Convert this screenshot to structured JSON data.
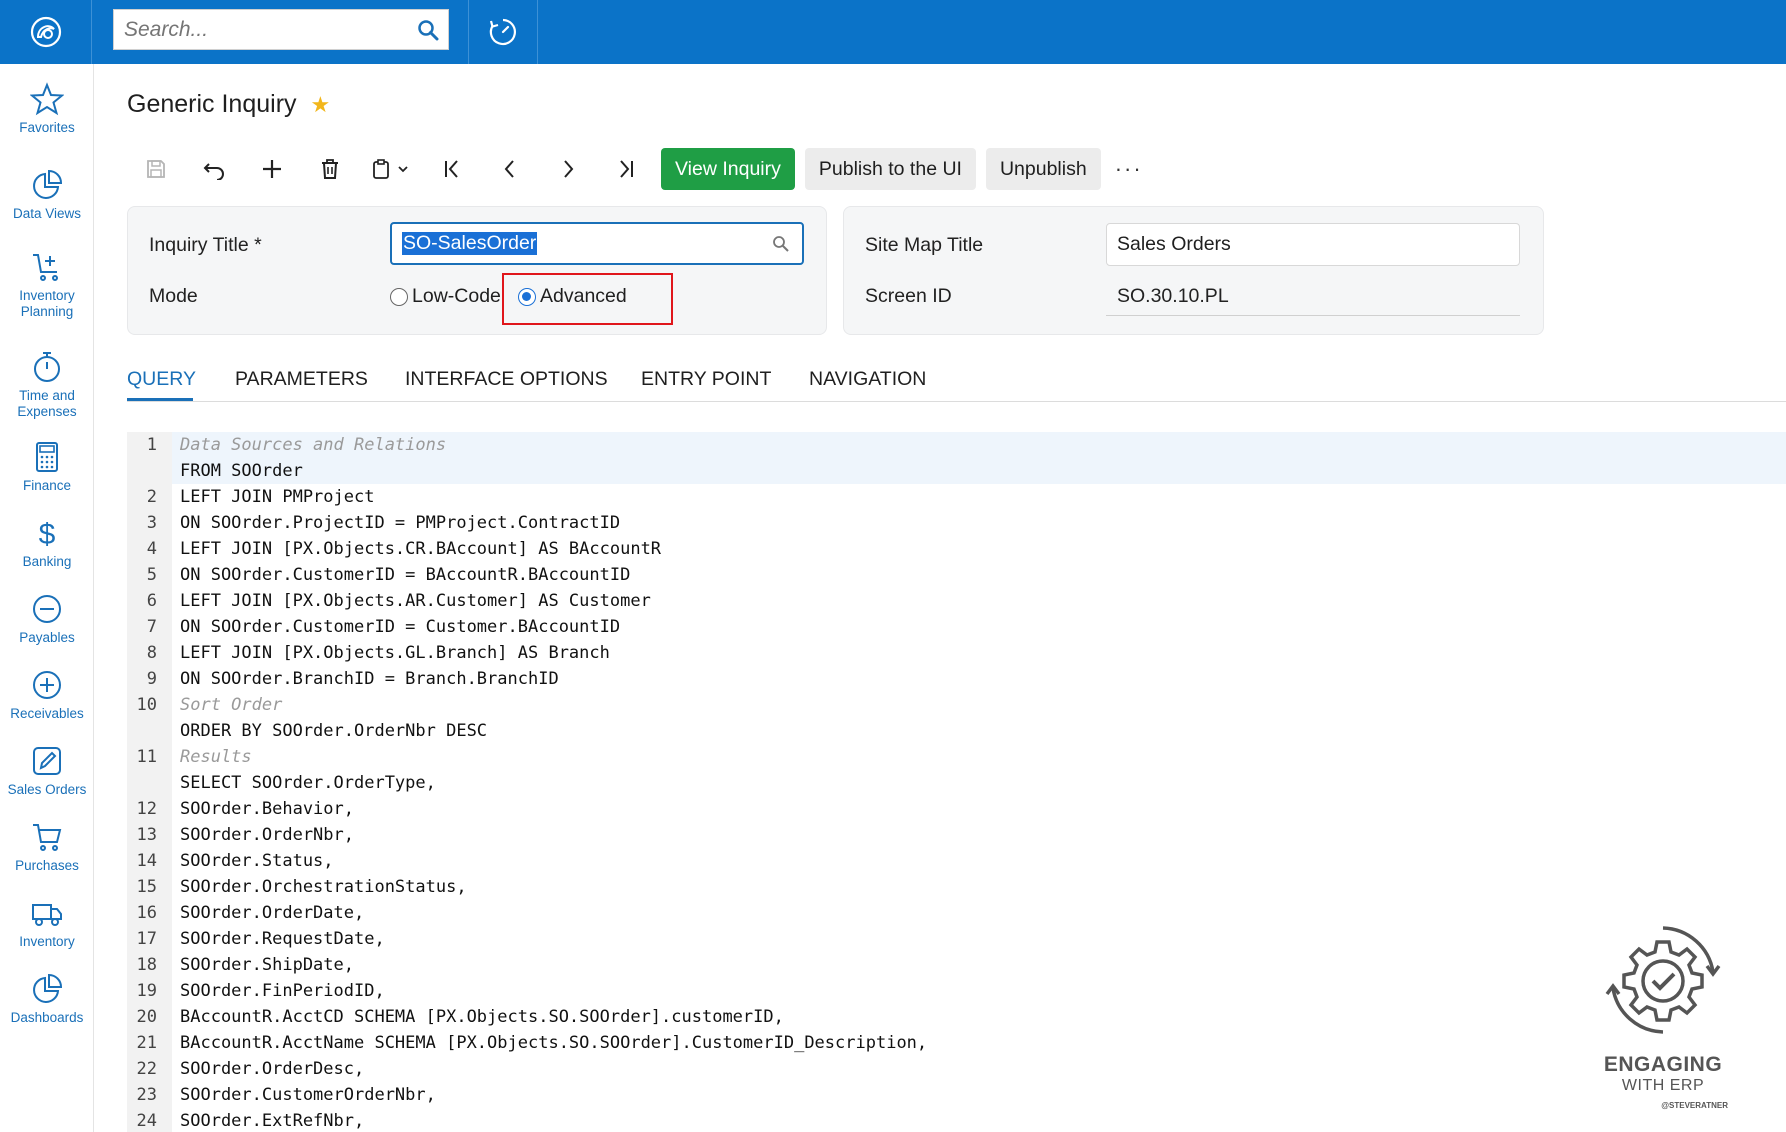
{
  "search": {
    "placeholder": "Search..."
  },
  "sidebar": {
    "items": [
      {
        "label": "Favorites"
      },
      {
        "label": "Data Views"
      },
      {
        "label": "Inventory Planning"
      },
      {
        "label": "Time and Expenses"
      },
      {
        "label": "Finance"
      },
      {
        "label": "Banking"
      },
      {
        "label": "Payables"
      },
      {
        "label": "Receivables"
      },
      {
        "label": "Sales Orders"
      },
      {
        "label": "Purchases"
      },
      {
        "label": "Inventory"
      },
      {
        "label": "Dashboards"
      }
    ]
  },
  "page": {
    "title": "Generic Inquiry"
  },
  "toolbar": {
    "view_inquiry": "View Inquiry",
    "publish": "Publish to the UI",
    "unpublish": "Unpublish",
    "more": "···"
  },
  "form": {
    "inquiry_title_label": "Inquiry Title *",
    "inquiry_title_value": "SO-SalesOrder",
    "mode_label": "Mode",
    "mode_low_code": "Low-Code",
    "mode_advanced": "Advanced",
    "mode_selected": "Advanced",
    "site_map_title_label": "Site Map Title",
    "site_map_title_value": "Sales Orders",
    "screen_id_label": "Screen ID",
    "screen_id_value": "SO.30.10.PL"
  },
  "tabs": [
    "QUERY",
    "PARAMETERS",
    "INTERFACE OPTIONS",
    "ENTRY POINT",
    "NAVIGATION"
  ],
  "active_tab": "QUERY",
  "editor": {
    "lines": [
      {
        "num": "1",
        "code": "Data Sources and Relations",
        "comment": true
      },
      {
        "num": "",
        "code": "FROM SOOrder"
      },
      {
        "num": "2",
        "code": "LEFT JOIN PMProject"
      },
      {
        "num": "3",
        "code": "ON SOOrder.ProjectID = PMProject.ContractID"
      },
      {
        "num": "4",
        "code": "LEFT JOIN [PX.Objects.CR.BAccount] AS BAccountR"
      },
      {
        "num": "5",
        "code": "ON SOOrder.CustomerID = BAccountR.BAccountID"
      },
      {
        "num": "6",
        "code": "LEFT JOIN [PX.Objects.AR.Customer] AS Customer"
      },
      {
        "num": "7",
        "code": "ON SOOrder.CustomerID = Customer.BAccountID"
      },
      {
        "num": "8",
        "code": "LEFT JOIN [PX.Objects.GL.Branch] AS Branch"
      },
      {
        "num": "9",
        "code": "ON SOOrder.BranchID = Branch.BranchID"
      },
      {
        "num": "10",
        "code": "Sort Order",
        "comment": true
      },
      {
        "num": "",
        "code": "ORDER BY SOOrder.OrderNbr DESC"
      },
      {
        "num": "11",
        "code": "Results",
        "comment": true
      },
      {
        "num": "",
        "code": "SELECT SOOrder.OrderType,"
      },
      {
        "num": "12",
        "code": "SOOrder.Behavior,"
      },
      {
        "num": "13",
        "code": "SOOrder.OrderNbr,"
      },
      {
        "num": "14",
        "code": "SOOrder.Status,"
      },
      {
        "num": "15",
        "code": "SOOrder.OrchestrationStatus,"
      },
      {
        "num": "16",
        "code": "SOOrder.OrderDate,"
      },
      {
        "num": "17",
        "code": "SOOrder.RequestDate,"
      },
      {
        "num": "18",
        "code": "SOOrder.ShipDate,"
      },
      {
        "num": "19",
        "code": "SOOrder.FinPeriodID,"
      },
      {
        "num": "20",
        "code": "BAccountR.AcctCD SCHEMA [PX.Objects.SO.SOOrder].customerID,"
      },
      {
        "num": "21",
        "code": "BAccountR.AcctName SCHEMA [PX.Objects.SO.SOOrder].CustomerID_Description,"
      },
      {
        "num": "22",
        "code": "SOOrder.OrderDesc,"
      },
      {
        "num": "23",
        "code": "SOOrder.CustomerOrderNbr,"
      },
      {
        "num": "24",
        "code": "SOOrder.ExtRefNbr,"
      }
    ]
  },
  "watermark": {
    "line1": "ENGAGING",
    "line2": "WITH ERP",
    "line3": "@STEVERATNER"
  },
  "colors": {
    "topbar": "#0b73c8",
    "accent": "#1a70b8",
    "primary_button": "#1f9e45",
    "highlight_box": "#e0161b",
    "star": "#f2b61b"
  }
}
